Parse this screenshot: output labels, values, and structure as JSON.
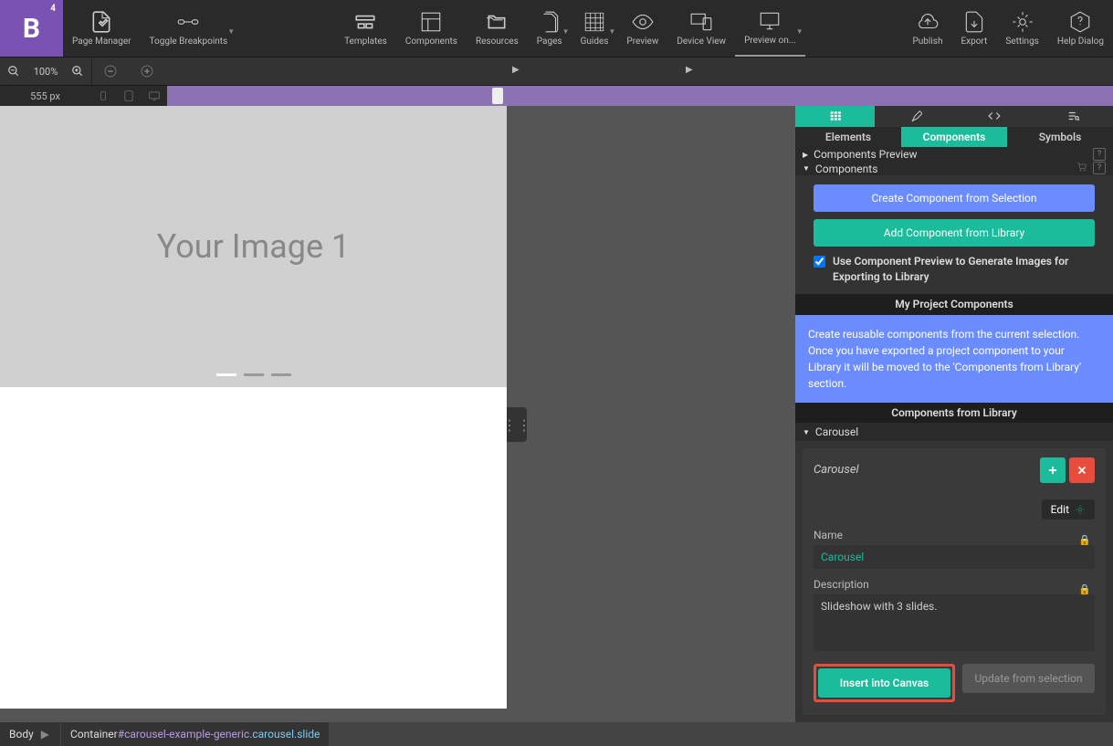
{
  "logo": {
    "text": "B",
    "badge": "4"
  },
  "toolbar": {
    "items": [
      {
        "label": "Page Manager"
      },
      {
        "label": "Toggle Breakpoints"
      },
      {
        "label": "Templates"
      },
      {
        "label": "Components"
      },
      {
        "label": "Resources"
      },
      {
        "label": "Pages"
      },
      {
        "label": "Guides"
      },
      {
        "label": "Preview"
      },
      {
        "label": "Device View"
      },
      {
        "label": "Preview on..."
      },
      {
        "label": "Publish"
      },
      {
        "label": "Export"
      },
      {
        "label": "Settings"
      },
      {
        "label": "Help Dialog"
      }
    ]
  },
  "zoom": {
    "value": "100%"
  },
  "size": {
    "value": "555 px"
  },
  "canvas": {
    "placeholder": "Your Image 1"
  },
  "rightPanel": {
    "tabs2": [
      "Elements",
      "Components",
      "Symbols"
    ],
    "sectionPreview": "Components Preview",
    "sectionComponents": "Components",
    "btnCreate": "Create Component from Selection",
    "btnAdd": "Add Component from Library",
    "checkboxLabel": "Use Component Preview to Generate Images for Exporting to Library",
    "myProjHdr": "My Project Components",
    "infoText": "Create reusable components from the current selection. Once you have exported a project component to your Library it will be moved to the 'Components from Library' section.",
    "libHdr": "Components from Library",
    "carouselHdr": "Carousel",
    "card": {
      "title": "Carousel",
      "editBtn": "Edit",
      "nameLabel": "Name",
      "nameValue": "Carousel",
      "descLabel": "Description",
      "descValue": "Slideshow with 3 slides.",
      "insertBtn": "Insert into Canvas",
      "updateBtn": "Update from selection"
    }
  },
  "breadcrumb": {
    "body": "Body",
    "container": "Container",
    "id": "#carousel-example-generic",
    "classes": ".carousel.slide"
  }
}
